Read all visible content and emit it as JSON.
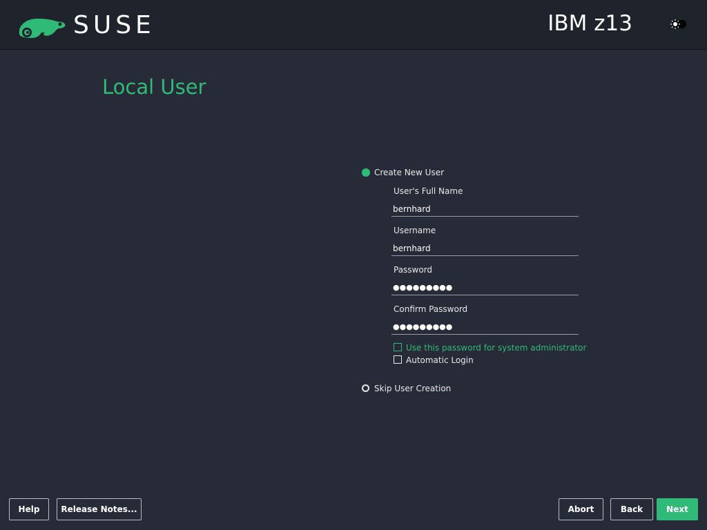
{
  "header": {
    "brand": "SUSE",
    "machine": "IBM z13",
    "theme_icon": "sun-toggle-icon"
  },
  "page": {
    "title": "Local User"
  },
  "options": {
    "create_new_user": {
      "label": "Create New User",
      "selected": true
    },
    "skip_user_creation": {
      "label": "Skip User Creation",
      "selected": false
    }
  },
  "form": {
    "full_name": {
      "label": "User's Full Name",
      "value": "bernhard"
    },
    "username": {
      "label": "Username",
      "value": "bernhard"
    },
    "password": {
      "label": "Password",
      "masked": "●●●●●●●●●"
    },
    "confirm_password": {
      "label": "Confirm Password",
      "masked": "●●●●●●●●●"
    },
    "use_for_admin": {
      "label": "Use this password for system administrator",
      "checked": false
    },
    "automatic_login": {
      "label": "Automatic Login",
      "checked": false
    }
  },
  "buttons": {
    "help": "Help",
    "release_notes": "Release Notes...",
    "abort": "Abort",
    "back": "Back",
    "next": "Next"
  },
  "colors": {
    "accent": "#30ba78",
    "background": "#272b37",
    "header": "#1f232b"
  }
}
